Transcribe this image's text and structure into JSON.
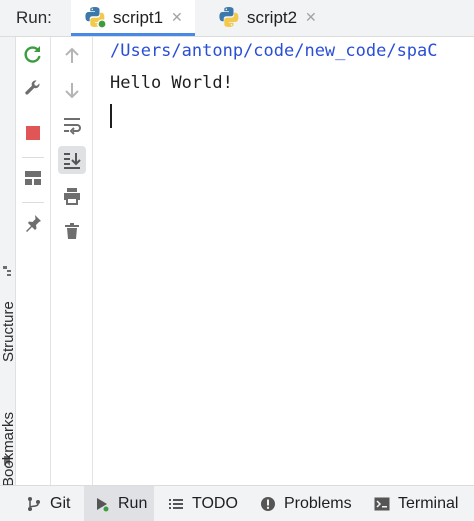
{
  "header": {
    "run_label": "Run:",
    "tabs": [
      {
        "label": "script1",
        "close": "✕",
        "active": true,
        "icon": "python-icon"
      },
      {
        "label": "script2",
        "close": "✕",
        "active": false,
        "icon": "python-icon"
      }
    ]
  },
  "side_stripe": {
    "structure_label": "Structure",
    "bookmarks_label": "Bookmarks"
  },
  "console": {
    "path_line": "/Users/antonp/code/new_code/spaC",
    "output_line": "Hello World!"
  },
  "bottom_bar": {
    "items": [
      {
        "label": "Git",
        "icon": "git-branch-icon"
      },
      {
        "label": "Run",
        "icon": "run-icon",
        "active": true
      },
      {
        "label": "TODO",
        "icon": "todo-list-icon"
      },
      {
        "label": "Problems",
        "icon": "problems-icon"
      },
      {
        "label": "Terminal",
        "icon": "terminal-icon"
      }
    ]
  },
  "colors": {
    "accent": "#4a88e6",
    "rerun_green": "#3d9c3f",
    "stop_red": "#e05555",
    "path_blue": "#2a4fd6"
  }
}
